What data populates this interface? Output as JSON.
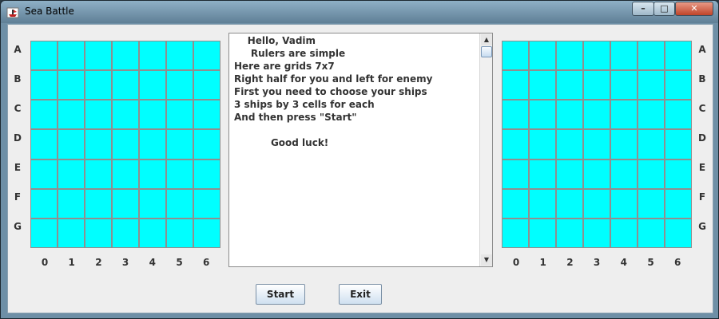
{
  "window": {
    "title": "Sea Battle"
  },
  "grid": {
    "rows": [
      "A",
      "B",
      "C",
      "D",
      "E",
      "F",
      "G"
    ],
    "cols": [
      "0",
      "1",
      "2",
      "3",
      "4",
      "5",
      "6"
    ],
    "cell_color": "#00ffff"
  },
  "message_lines": [
    "    Hello, Vadim",
    "     Rulers are simple",
    "Here are grids 7x7",
    "Right half for you and left for enemy",
    "First you need to choose your ships",
    "3 ships by 3 cells for each",
    "And then press \"Start\"",
    "",
    "           Good luck!"
  ],
  "buttons": {
    "start": "Start",
    "exit": "Exit"
  },
  "icons": {
    "window": "ship-app-icon",
    "minimize": "minimize-icon",
    "maximize": "maximize-icon",
    "close": "close-icon"
  }
}
